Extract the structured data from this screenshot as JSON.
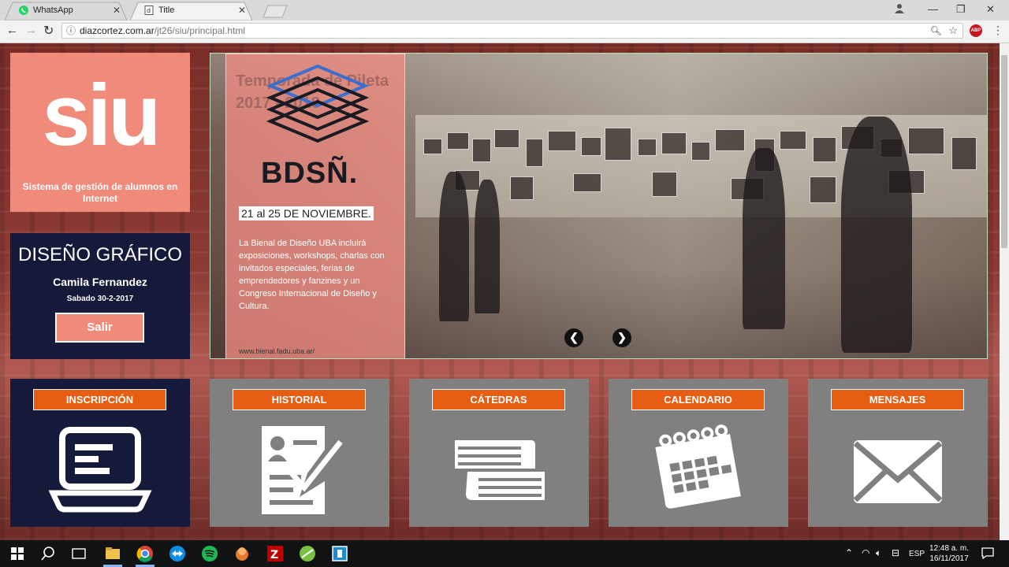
{
  "browser": {
    "tabs": [
      {
        "label": "WhatsApp",
        "icon": "whatsapp-icon",
        "active": false
      },
      {
        "label": "Title",
        "icon": "page-icon",
        "active": true
      }
    ],
    "url_host": "diazcortez.com.ar",
    "url_path": "/jt26/siu/principal.html",
    "extension_badge": "ABP"
  },
  "sidebar": {
    "logo": "SIU",
    "subtitle": "Sistema de gestión de alumnos en Internet",
    "career": "DISEÑO GRÁFICO",
    "user_name": "Camila Fernandez",
    "date": "Sabado 30-2-2017",
    "logout_label": "Salir"
  },
  "carousel": {
    "poster_title": "Temporada de Pileta 2017 - 2018",
    "brand": "BDSÑ.",
    "dates": "21 al 25 DE NOVIEMBRE.",
    "description": "La Bienal de Diseño UBA incluirá exposiciones, workshops, charlas con invitados especiales, ferias de emprendedores y fanzines y un Congreso Internacional de Diseño y Cultura.",
    "url": "www.bienal.fadu.uba.ar/",
    "prev_label": "❮",
    "next_label": "❯"
  },
  "tiles": [
    {
      "label": "INSCRIPCIÓN",
      "icon": "laptop-icon"
    },
    {
      "label": "HISTORIAL",
      "icon": "resume-check-icon"
    },
    {
      "label": "CÁTEDRAS",
      "icon": "books-icon"
    },
    {
      "label": "CALENDARIO",
      "icon": "calendar-icon"
    },
    {
      "label": "MENSAJES",
      "icon": "envelope-icon"
    }
  ],
  "taskbar": {
    "language": "ESP",
    "time": "12:48 a. m.",
    "date": "16/11/2017"
  },
  "colors": {
    "accent": "#e75d13",
    "salmon": "#f08a7a",
    "navy": "#15193a",
    "tile_gray": "#808080"
  }
}
